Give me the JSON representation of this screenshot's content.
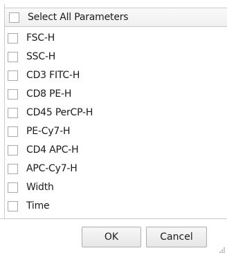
{
  "select_all": {
    "label": "Select All Parameters",
    "checked": false
  },
  "parameters": [
    {
      "label": "FSC-H",
      "checked": false
    },
    {
      "label": "SSC-H",
      "checked": false
    },
    {
      "label": "CD3 FITC-H",
      "checked": false
    },
    {
      "label": "CD8 PE-H",
      "checked": false
    },
    {
      "label": "CD45 PerCP-H",
      "checked": false
    },
    {
      "label": "PE-Cy7-H",
      "checked": false
    },
    {
      "label": "CD4 APC-H",
      "checked": false
    },
    {
      "label": "APC-Cy7-H",
      "checked": false
    },
    {
      "label": "Width",
      "checked": false
    },
    {
      "label": "Time",
      "checked": false
    }
  ],
  "buttons": {
    "ok": "OK",
    "cancel": "Cancel"
  },
  "icons": {
    "resize_grip": "resize-grip-icon"
  }
}
